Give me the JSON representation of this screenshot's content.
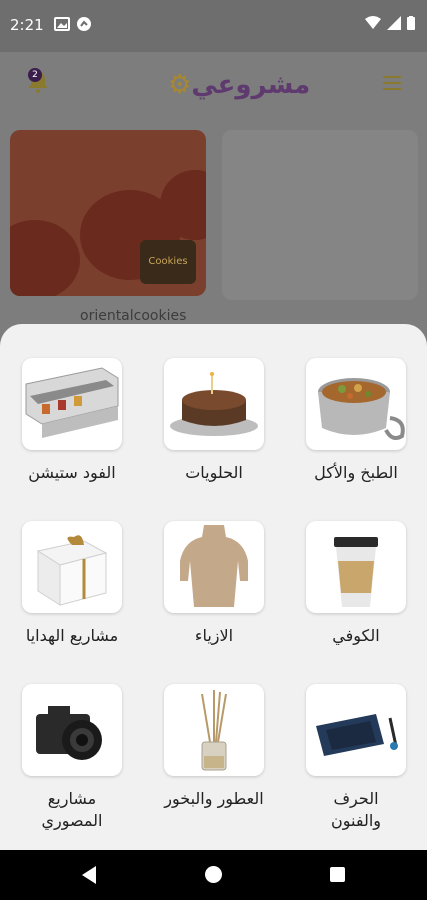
{
  "status_bar": {
    "time": "2:21"
  },
  "header": {
    "notification_count": "2",
    "logo_text": "مشروعي"
  },
  "featured": {
    "brand_label": "Cookies",
    "shop_name": "orientalcookies"
  },
  "categories": [
    {
      "label": "الطبخ والأكل",
      "icon": "cooking-pot-icon"
    },
    {
      "label": "الحلويات",
      "icon": "cake-icon"
    },
    {
      "label": "الفود ستيشن",
      "icon": "food-station-icon"
    },
    {
      "label": "الكوفي",
      "icon": "coffee-cup-icon"
    },
    {
      "label": "الازياء",
      "icon": "mannequin-icon"
    },
    {
      "label": "مشاريع الهدايا",
      "icon": "gift-box-icon"
    },
    {
      "label": "الحرف والفنون",
      "icon": "drawing-tablet-icon"
    },
    {
      "label": "العطور والبخور",
      "icon": "reed-diffuser-icon"
    },
    {
      "label": "مشاريع المصوري",
      "icon": "camera-icon"
    }
  ],
  "colors": {
    "sheet_bg": "#f1f1f1",
    "overlay": "#7d7d7d",
    "brand_purple": "#5e3a6e",
    "brand_gold": "#a8872e"
  }
}
